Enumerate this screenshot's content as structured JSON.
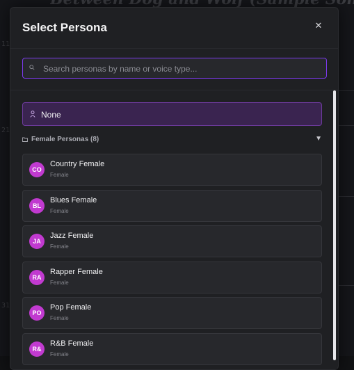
{
  "background": {
    "title": "Between Dog and Wolf (Sample Song)",
    "line_numbers": [
      "11",
      "21",
      "31"
    ]
  },
  "modal": {
    "title": "Select Persona",
    "close_icon": "close-icon"
  },
  "search": {
    "placeholder": "Search personas by name or voice type...",
    "value": "",
    "icon": "search-icon"
  },
  "none_option": {
    "label": "None",
    "icon": "user-icon"
  },
  "group": {
    "label": "Female Personas (8)",
    "icon": "folder-icon",
    "expanded_indicator": "▼"
  },
  "personas": [
    {
      "initials": "CO",
      "name": "Country Female",
      "voice_type": "Female"
    },
    {
      "initials": "BL",
      "name": "Blues Female",
      "voice_type": "Female"
    },
    {
      "initials": "JA",
      "name": "Jazz Female",
      "voice_type": "Female"
    },
    {
      "initials": "RA",
      "name": "Rapper Female",
      "voice_type": "Female"
    },
    {
      "initials": "PO",
      "name": "Pop Female",
      "voice_type": "Female"
    },
    {
      "initials": "R&",
      "name": "R&B Female",
      "voice_type": "Female"
    }
  ],
  "colors": {
    "accent": "#7c3aed",
    "avatar": "#c13ad0",
    "selected_bg": "#3a2450"
  }
}
